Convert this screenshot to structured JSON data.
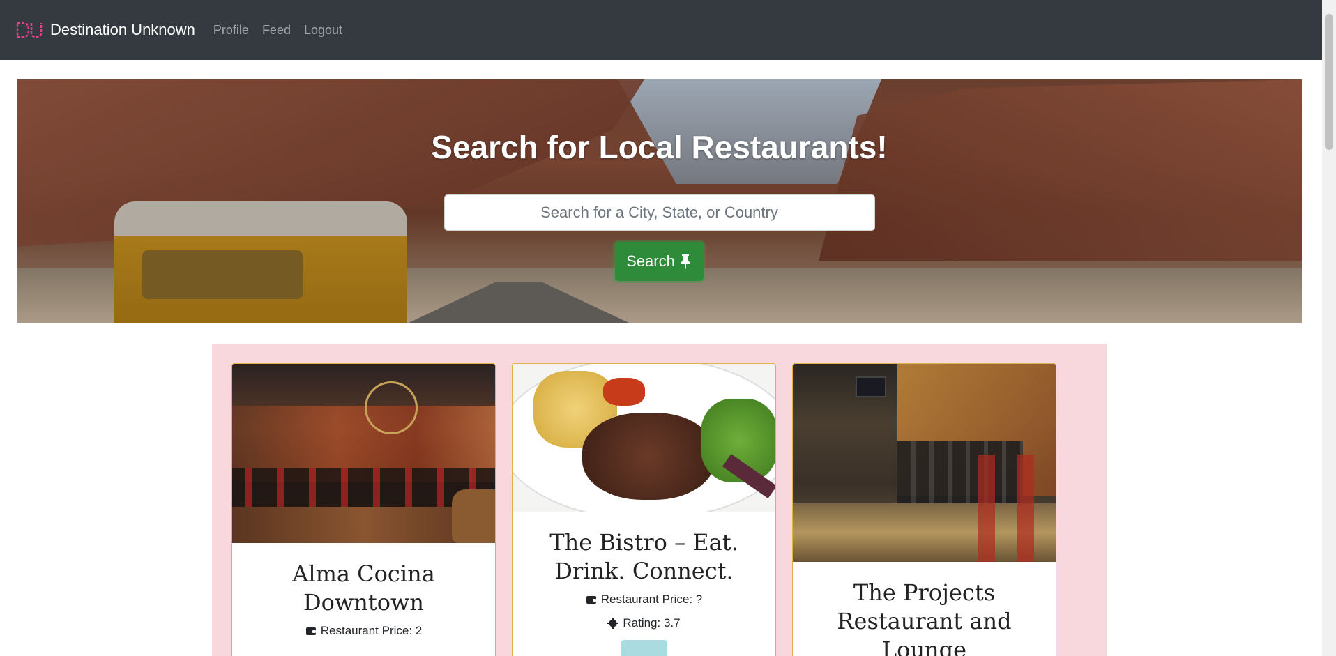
{
  "nav": {
    "brand": "Destination Unknown",
    "links": [
      "Profile",
      "Feed",
      "Logout"
    ],
    "accent": "#e83e8c"
  },
  "hero": {
    "title": "Search for Local Restaurants!",
    "search_placeholder": "Search for a City, State, or Country",
    "search_value": "",
    "search_button": "Search",
    "button_color": "#2e8b3a"
  },
  "results": {
    "background": "#f8d7dd",
    "cards": [
      {
        "name": "Alma Cocina Downtown",
        "price_label": "Restaurant Price: 2"
      },
      {
        "name": "The Bistro – Eat. Drink. Connect.",
        "price_label": "Restaurant Price: ?",
        "rating_label": "Rating: 3.7"
      },
      {
        "name": "The Projects Restaurant and Lounge"
      }
    ]
  }
}
